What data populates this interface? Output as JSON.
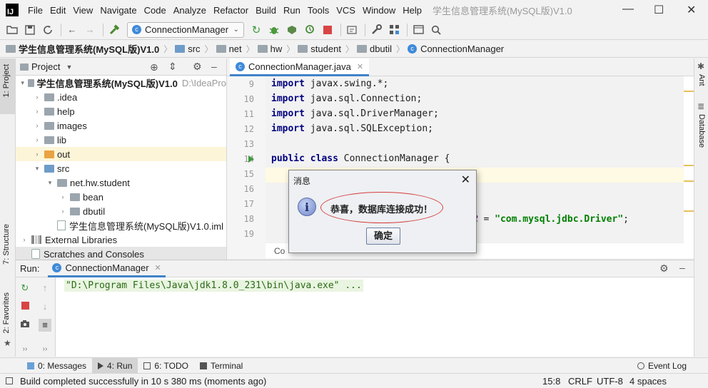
{
  "app": {
    "logo": "IJ",
    "title": "学生信息管理系统(MySQL版)V1.0",
    "window_controls": {
      "minimize": "—",
      "maximize": "☐",
      "close": "✕"
    }
  },
  "menu": [
    "File",
    "Edit",
    "View",
    "Navigate",
    "Code",
    "Analyze",
    "Refactor",
    "Build",
    "Run",
    "Tools",
    "VCS",
    "Window",
    "Help"
  ],
  "toolbar": {
    "run_config": "ConnectionManager",
    "icons": [
      "folder-open-icon",
      "save-icon",
      "sync-icon",
      "back-icon",
      "forward-icon",
      "build-hammer-icon",
      "rerun-icon",
      "debug-icon",
      "coverage-icon",
      "profile-icon",
      "stop-icon",
      "vcs-icon",
      "settings-wrench-icon",
      "project-structure-icon",
      "terminal-window-icon",
      "search-icon"
    ]
  },
  "breadcrumb": [
    "学生信息管理系统(MySQL版)V1.0",
    "src",
    "net",
    "hw",
    "student",
    "dbutil",
    "ConnectionManager"
  ],
  "left_strip": {
    "project": "1: Project",
    "structure": "7: Structure",
    "favorites": "2: Favorites"
  },
  "right_strip": {
    "ant": "Ant",
    "database": "Database"
  },
  "project_panel": {
    "title": "Project",
    "tree": [
      {
        "label": "学生信息管理系统(MySQL版)V1.0",
        "suffix": "D:\\IdeaPro",
        "indent": 0,
        "arrow": "▾",
        "icon": "folder",
        "bold": true
      },
      {
        "label": ".idea",
        "indent": 1,
        "arrow": "›",
        "icon": "folder"
      },
      {
        "label": "help",
        "indent": 1,
        "arrow": "›",
        "icon": "folder"
      },
      {
        "label": "images",
        "indent": 1,
        "arrow": "›",
        "icon": "folder"
      },
      {
        "label": "lib",
        "indent": 1,
        "arrow": "›",
        "icon": "folder"
      },
      {
        "label": "out",
        "indent": 1,
        "arrow": "›",
        "icon": "folder-orange",
        "highlight": true
      },
      {
        "label": "src",
        "indent": 1,
        "arrow": "▾",
        "icon": "folder-blue"
      },
      {
        "label": "net.hw.student",
        "indent": 2,
        "arrow": "▾",
        "icon": "folder"
      },
      {
        "label": "bean",
        "indent": 3,
        "arrow": "›",
        "icon": "folder"
      },
      {
        "label": "dbutil",
        "indent": 3,
        "arrow": "›",
        "icon": "folder"
      },
      {
        "label": "学生信息管理系统(MySQL版)V1.0.iml",
        "indent": 2,
        "arrow": "",
        "icon": "file"
      },
      {
        "label": "External Libraries",
        "indent": 0,
        "arrow": "›",
        "icon": "lib"
      },
      {
        "label": "Scratches and Consoles",
        "indent": 0,
        "arrow": "",
        "icon": "scratch"
      }
    ]
  },
  "editor": {
    "tab": "ConnectionManager.java",
    "line_numbers": [
      "9",
      "10",
      "11",
      "12",
      "13",
      "14",
      "15",
      "16",
      "17",
      "18",
      "19"
    ],
    "lines": [
      [
        "import",
        " javax.swing.*;"
      ],
      [
        "import",
        " java.sql.Connection;"
      ],
      [
        "import",
        " java.sql.DriverManager;"
      ],
      [
        "import",
        " java.sql.SQLException;"
      ],
      [
        "",
        ""
      ],
      [
        "public class",
        " ConnectionManager {"
      ],
      [
        "",
        ""
      ],
      [
        "",
        ""
      ],
      [
        "",
        ""
      ],
      [
        "",
        ""
      ],
      [
        "",
        ""
      ]
    ],
    "line18_const": "ER",
    "line18_eq": " = ",
    "line18_str": "\"com.mysql.jdbc.Driver\"",
    "line18_end": ";",
    "bottom_crumb": "Co"
  },
  "run_panel": {
    "label": "Run:",
    "tab": "ConnectionManager",
    "console": "\"D:\\Program Files\\Java\\jdk1.8.0_231\\bin\\java.exe\" ..."
  },
  "bottom_tabs": [
    {
      "label": "0: Messages",
      "active": false
    },
    {
      "label": "4: Run",
      "active": true
    },
    {
      "label": "6: TODO",
      "active": false
    },
    {
      "label": "Terminal",
      "active": false
    }
  ],
  "event_log": "Event Log",
  "status": {
    "message": "Build completed successfully in 10 s 380 ms (moments ago)",
    "position": "15:8",
    "line_sep": "CRLF",
    "encoding": "UTF-8",
    "indent": "4 spaces"
  },
  "dialog": {
    "title": "消息",
    "close": "✕",
    "icon": "i",
    "message": "恭喜，数据库连接成功！",
    "ok": "确定"
  }
}
